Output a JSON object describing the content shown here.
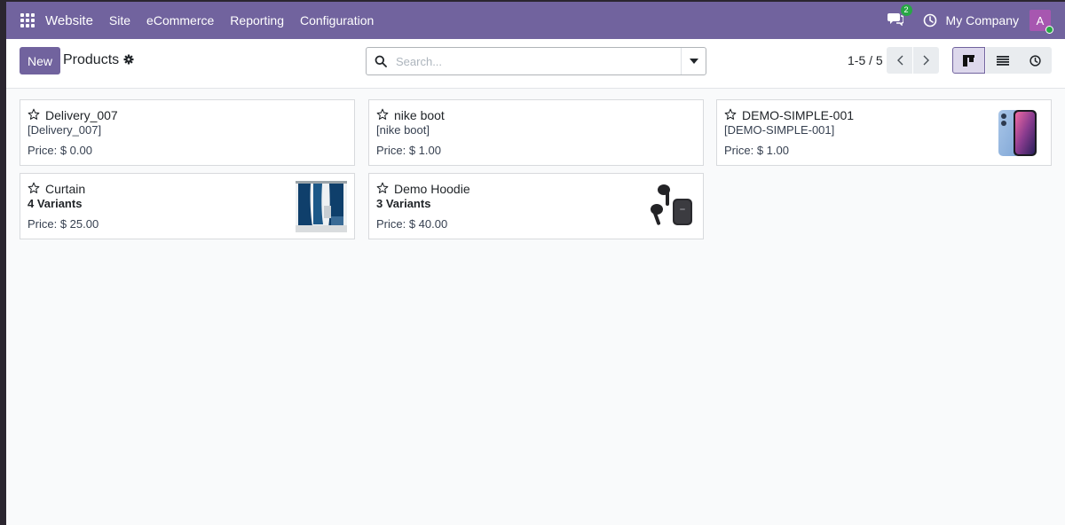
{
  "navbar": {
    "brand": "Website",
    "menu": [
      "Site",
      "eCommerce",
      "Reporting",
      "Configuration"
    ],
    "chat_count": "2",
    "company": "My Company",
    "avatar_letter": "A",
    "accent_color": "#71639e"
  },
  "control_panel": {
    "new_label": "New",
    "title": "Products",
    "search_placeholder": "Search...",
    "pager": "1-5 / 5"
  },
  "products": [
    {
      "name": "Delivery_007",
      "sub": "[Delivery_007]",
      "price": "Price: $ 0.00",
      "image": "none"
    },
    {
      "name": "nike boot",
      "sub": "[nike boot]",
      "price": "Price: $ 1.00",
      "image": "none"
    },
    {
      "name": "DEMO-SIMPLE-001",
      "sub": "[DEMO-SIMPLE-001]",
      "price": "Price: $ 1.00",
      "image": "phone"
    },
    {
      "name": "Curtain",
      "sub": "4 Variants",
      "price": "Price: $ 25.00",
      "image": "curtain"
    },
    {
      "name": "Demo Hoodie",
      "sub": "3 Variants",
      "price": "Price: $ 40.00",
      "image": "earbuds"
    }
  ]
}
